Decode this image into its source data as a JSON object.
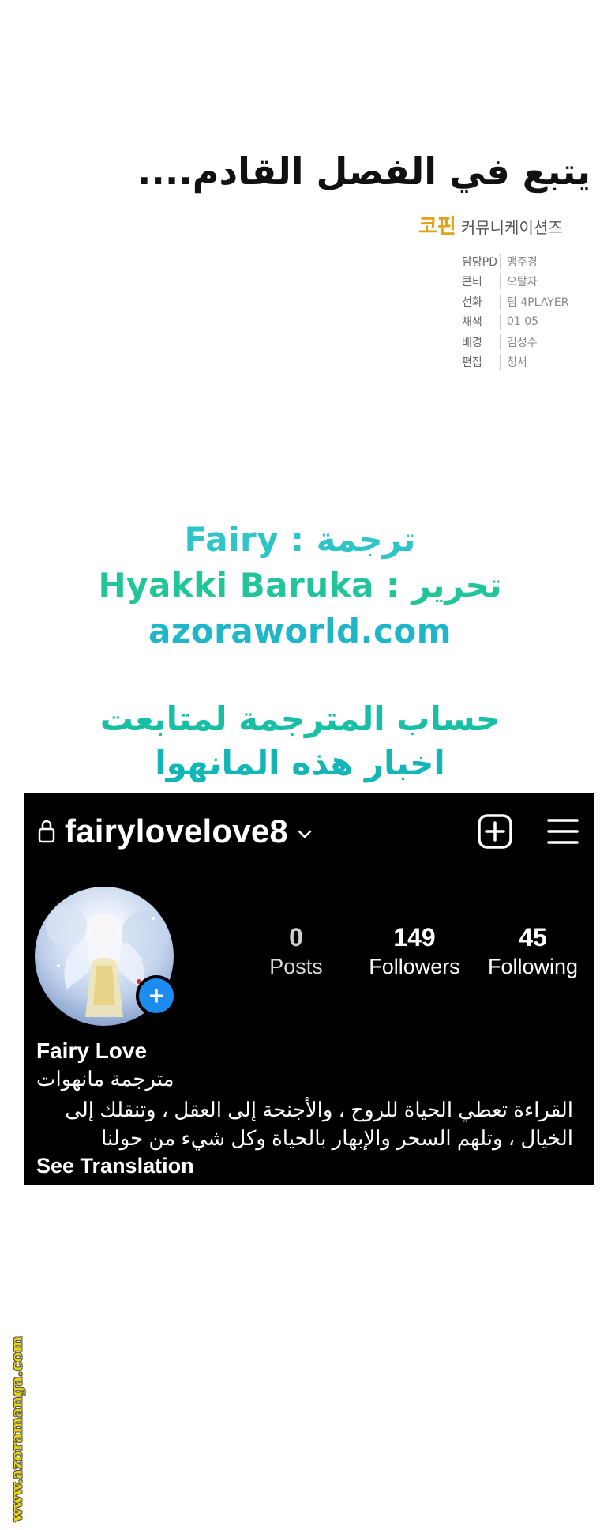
{
  "tbc_text": "يتبع في الفصل القادم....",
  "credits": {
    "publisher_brand": "코핀",
    "publisher_name": "커뮤니케이션즈",
    "rows": [
      {
        "role": "담당PD",
        "person": "맹주경"
      },
      {
        "role": "콘티",
        "person": "오탈자"
      },
      {
        "role": "선화",
        "person": "팀 4PLAYER"
      },
      {
        "role": "채색",
        "person": "01 05"
      },
      {
        "role": "배경",
        "person": "김성수"
      },
      {
        "role": "편집",
        "person": "청서"
      }
    ]
  },
  "team": {
    "translator": "Fairy : ترجمة",
    "editor": "Hyakki Baruka : تحرير",
    "site": "azoraworld.com"
  },
  "follow": {
    "line1": "حساب المترجمة لمتابعت",
    "line2": "اخبار هذه المانهوا"
  },
  "instagram": {
    "username": "fairylovelove8",
    "stats": [
      {
        "value": "0",
        "label": "Posts"
      },
      {
        "value": "149",
        "label": "Followers"
      },
      {
        "value": "45",
        "label": "Following"
      }
    ],
    "display_name": "Fairy Love",
    "subtitle": "مترجمة مانهوات",
    "bio_line1": "القراءة تعطي الحياة للروح ، والأجنحة إلى العقل ، وتنقلك إلى",
    "bio_line2": "الخيال ، وتلهم السحر والإبهار بالحياة وكل شيء من حولنا",
    "see_translation": "See Translation",
    "plus_badge": "+"
  },
  "watermark": "www.azoramanga.com",
  "colors": {
    "instagram_bg": "#000000",
    "plus_badge": "#1d8cf0",
    "watermark": "#e8d40e",
    "team_text": "#27c3c0"
  }
}
